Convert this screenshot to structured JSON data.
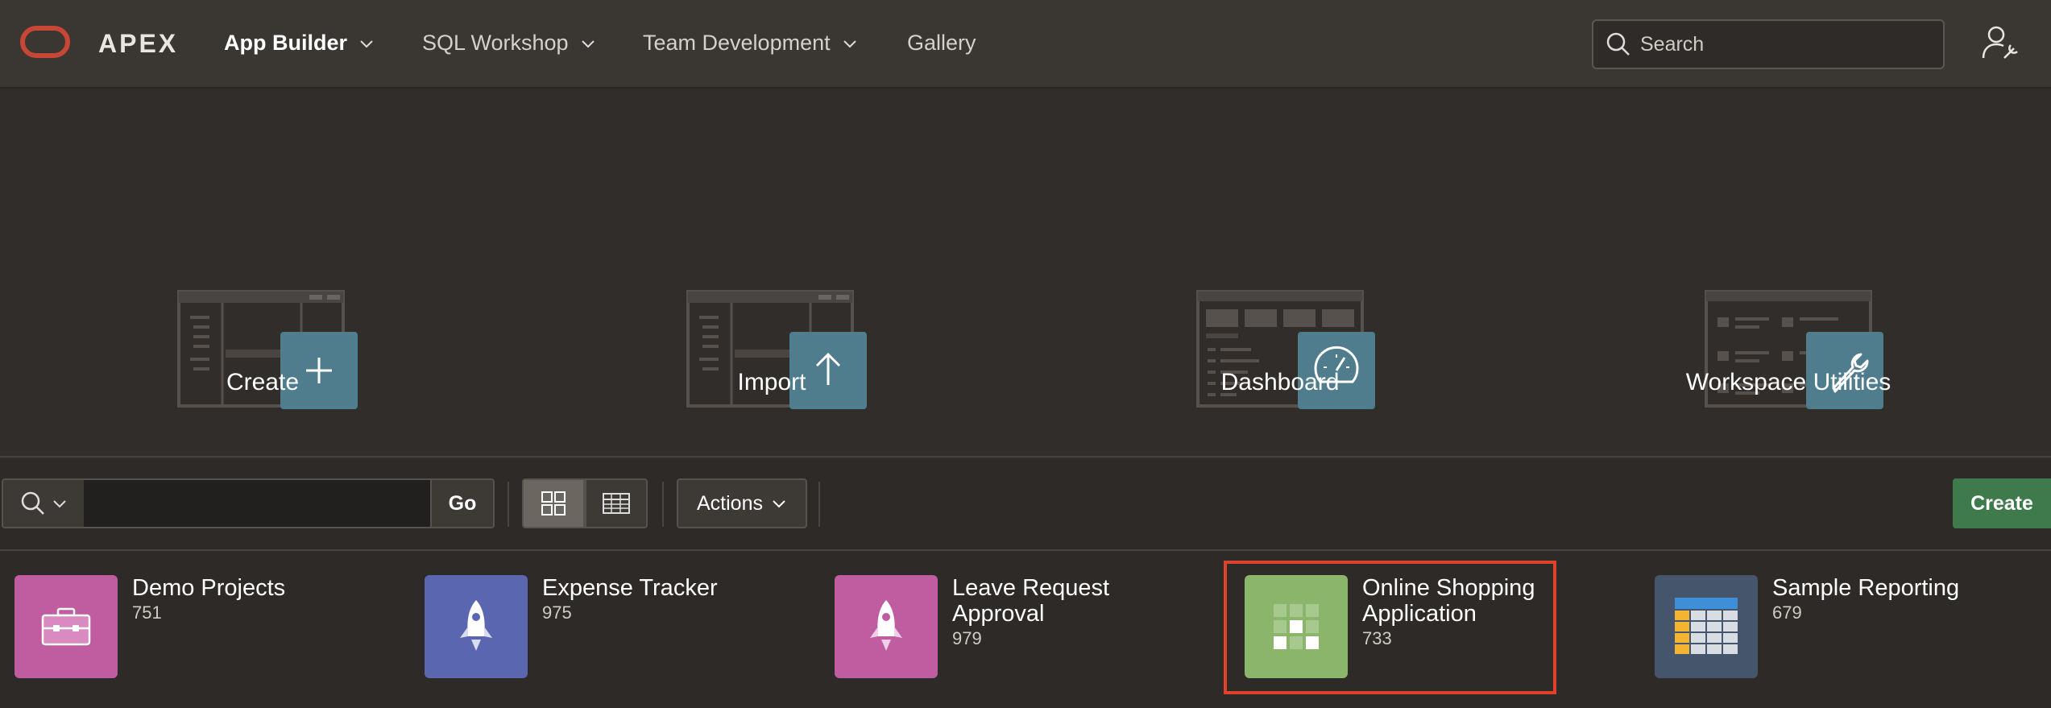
{
  "nav": {
    "logo_text": "APEX",
    "items": [
      {
        "label": "App Builder",
        "dropdown": true,
        "active": true
      },
      {
        "label": "SQL Workshop",
        "dropdown": true,
        "active": false
      },
      {
        "label": "Team Development",
        "dropdown": true,
        "active": false
      },
      {
        "label": "Gallery",
        "dropdown": false,
        "active": false
      }
    ],
    "search_placeholder": "Search"
  },
  "hero_tiles": [
    {
      "label": "Create",
      "icon": "plus-icon"
    },
    {
      "label": "Import",
      "icon": "arrow-up-icon"
    },
    {
      "label": "Dashboard",
      "icon": "gauge-icon"
    },
    {
      "label": "Workspace Utilities",
      "icon": "wrench-icon"
    }
  ],
  "toolbar": {
    "search_value": "",
    "go_label": "Go",
    "actions_label": "Actions",
    "create_label": "Create"
  },
  "apps": [
    {
      "name": "Demo Projects",
      "id": "751",
      "color": "#c05ca0",
      "icon": "briefcase-icon"
    },
    {
      "name": "Expense Tracker",
      "id": "975",
      "color": "#5b66b0",
      "icon": "rocket-icon"
    },
    {
      "name": "Leave Request Approval",
      "id": "979",
      "color": "#c05ca0",
      "icon": "rocket-icon"
    },
    {
      "name": "Online Shopping Application",
      "id": "733",
      "color": "#8bb56a",
      "icon": "grid-icon"
    },
    {
      "name": "Sample Reporting",
      "id": "679",
      "color": "#45556c",
      "icon": "spreadsheet-icon"
    }
  ],
  "colors": {
    "accent_tile": "#4f7d8e",
    "create_button": "#3f7a4c",
    "highlight": "#e0412a",
    "logo": "#c74634"
  }
}
